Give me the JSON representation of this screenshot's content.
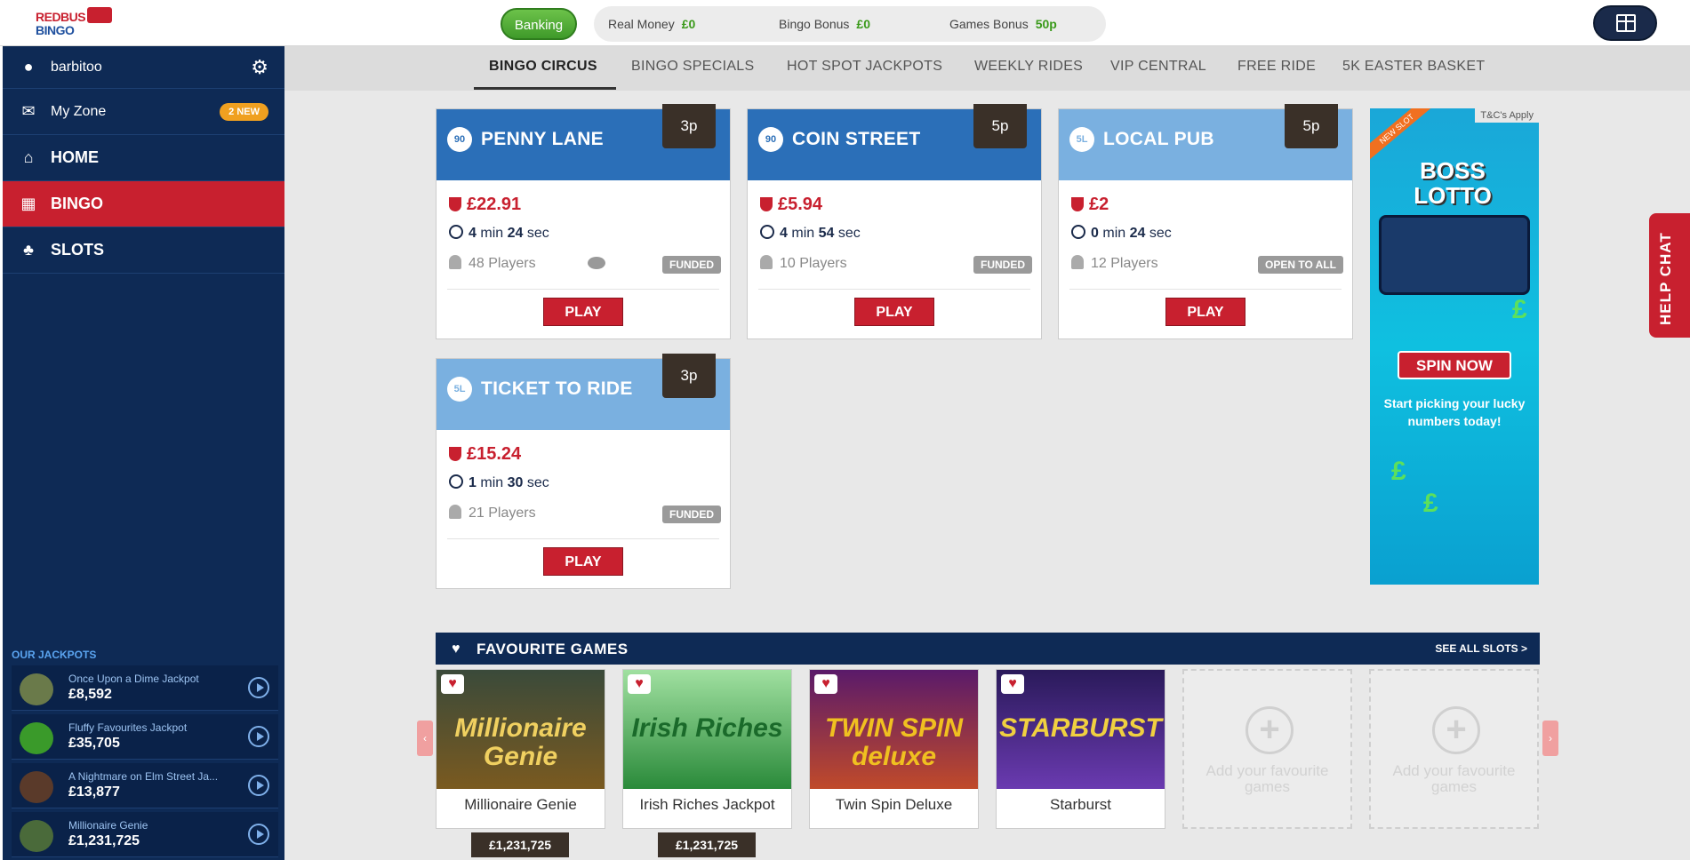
{
  "header": {
    "logo_line1": "REDBUS",
    "logo_line2": "BINGO",
    "banking_label": "Banking",
    "balances": [
      {
        "label": "Real Money",
        "value": "£0"
      },
      {
        "label": "Bingo Bonus",
        "value": "£0"
      },
      {
        "label": "Games Bonus",
        "value": "50p"
      }
    ],
    "gift_icon": "gift-icon"
  },
  "sidebar": {
    "username": "barbitoo",
    "my_zone_label": "My Zone",
    "my_zone_badge": "2 NEW",
    "nav": [
      {
        "label": "HOME",
        "icon": "home-icon"
      },
      {
        "label": "BINGO",
        "icon": "bingo-card-icon"
      },
      {
        "label": "SLOTS",
        "icon": "cherries-icon"
      }
    ],
    "jackpots_title": "OUR JACKPOTS",
    "jackpots": [
      {
        "name": "Once Upon a Dime Jackpot",
        "amount": "£8,592"
      },
      {
        "name": "Fluffy Favourites Jackpot",
        "amount": "£35,705"
      },
      {
        "name": "A Nightmare on Elm Street Ja...",
        "amount": "£13,877"
      },
      {
        "name": "Millionaire Genie",
        "amount": "£1,231,725"
      }
    ]
  },
  "tabs": [
    "BINGO CIRCUS",
    "BINGO SPECIALS",
    "HOT SPOT JACKPOTS",
    "WEEKLY RIDES",
    "VIP CENTRAL",
    "FREE RIDE",
    "5K EASTER BASKET"
  ],
  "rooms": [
    {
      "ball": "90",
      "name": "PENNY LANE",
      "price": "3p",
      "jackpot": "£22.91",
      "min": "4",
      "sec": "24",
      "players": "48 Players",
      "status": "FUNDED",
      "play": "PLAY"
    },
    {
      "ball": "90",
      "name": "COIN STREET",
      "price": "5p",
      "jackpot": "£5.94",
      "min": "4",
      "sec": "54",
      "players": "10 Players",
      "status": "FUNDED",
      "play": "PLAY"
    },
    {
      "ball": "5L",
      "name": "LOCAL PUB",
      "price": "5p",
      "jackpot": "£2",
      "min": "0",
      "sec": "24",
      "players": "12 Players",
      "status": "OPEN TO ALL",
      "play": "PLAY"
    },
    {
      "ball": "5L",
      "name": "TICKET TO RIDE",
      "price": "3p",
      "jackpot": "£15.24",
      "min": "1",
      "sec": "30",
      "players": "21 Players",
      "status": "FUNDED",
      "play": "PLAY"
    }
  ],
  "timer_min_label": "min",
  "timer_sec_label": "sec",
  "ad": {
    "tc": "T&C's Apply",
    "ribbon": "NEW SLOT",
    "title_line1": "BOSS",
    "title_line2": "LOTTO",
    "cta": "SPIN NOW",
    "tagline": "Start picking your lucky numbers today!"
  },
  "help_chat": "HELP CHAT",
  "favourites": {
    "title": "FAVOURITE GAMES",
    "see_all": "SEE ALL SLOTS >",
    "games": [
      {
        "name": "Millionaire Genie",
        "art": "Millionaire Genie",
        "jackpot": "£1,231,725",
        "color": "#2a3a2a"
      },
      {
        "name": "Irish Riches Jackpot",
        "art": "Irish Riches",
        "jackpot": "£1,231,725",
        "color": "#2a8a3a"
      },
      {
        "name": "Twin Spin Deluxe",
        "art": "TWIN SPIN deluxe",
        "jackpot": "",
        "color": "#3a1a4a"
      },
      {
        "name": "Starburst",
        "art": "STARBURST",
        "jackpot": "",
        "color": "#2a1a5a"
      }
    ],
    "empty_label": "Add your favourite games"
  },
  "colors": {
    "brand_red": "#c8202f",
    "sidebar_navy": "#0e2a55",
    "room_blue": "#2b6fb8",
    "room_light_blue": "#7ab0e0",
    "money_green": "#3a9a1a"
  }
}
